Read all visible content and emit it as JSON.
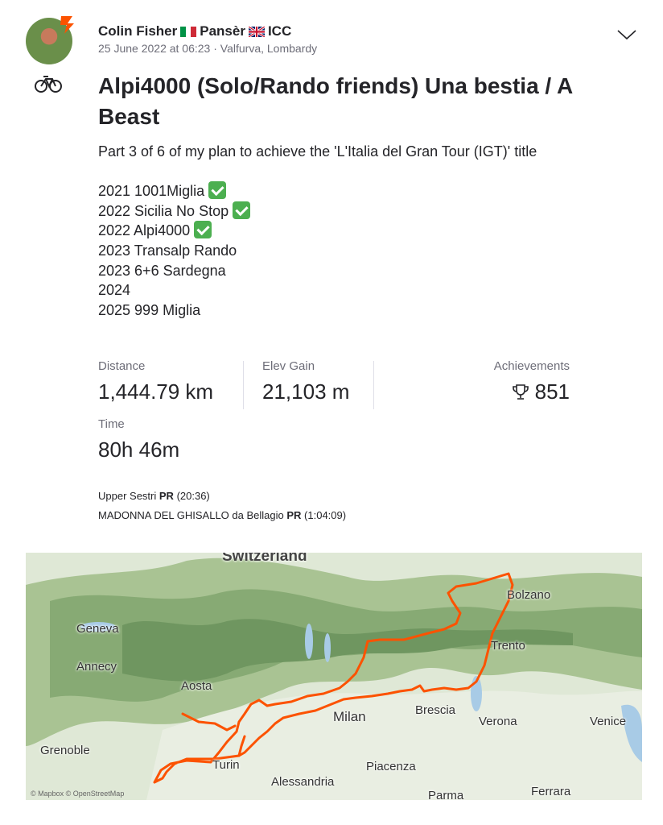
{
  "athlete": {
    "name": "Colin Fisher",
    "club1": "Pansèr",
    "club2": "ICC",
    "meta": "25 June 2022 at 06:23 · Valfurva, Lombardy"
  },
  "activity": {
    "title": "Alpi4000 (Solo/Rando friends) Una bestia / A Beast",
    "description_intro": "Part 3 of 6 of my plan to achieve the 'L'Italia del Gran Tour (IGT)' title",
    "plan": [
      {
        "text": "2021 1001Miglia",
        "done": true
      },
      {
        "text": "2022 Sicilia No Stop",
        "done": true
      },
      {
        "text": "2022 Alpi4000",
        "done": true
      },
      {
        "text": "2023 Transalp Rando",
        "done": false
      },
      {
        "text": "2023 6+6 Sardegna",
        "done": false
      },
      {
        "text": "2024",
        "done": false
      },
      {
        "text": "2025 999 Miglia",
        "done": false
      }
    ]
  },
  "stats": {
    "distance_label": "Distance",
    "distance_value": "1,444.79 km",
    "elev_label": "Elev Gain",
    "elev_value": "21,103 m",
    "achievements_label": "Achievements",
    "achievements_value": "851",
    "time_label": "Time",
    "time_value": "80h 46m"
  },
  "segments": [
    {
      "name": "Upper Sestri",
      "badge": "PR",
      "time": "(20:36)"
    },
    {
      "name": "MADONNA DEL GHISALLO da Bellagio",
      "badge": "PR",
      "time": "(1:04:09)"
    }
  ],
  "map": {
    "labels": {
      "switzerland": "Switzerland",
      "geneva": "Geneva",
      "annecy": "Annecy",
      "aosta": "Aosta",
      "grenoble": "Grenoble",
      "turin": "Turin",
      "alessandria": "Alessandria",
      "milan": "Milan",
      "piacenza": "Piacenza",
      "brescia": "Brescia",
      "verona": "Verona",
      "venice": "Venice",
      "parma": "Parma",
      "ferrara": "Ferrara",
      "bolzano": "Bolzano",
      "trento": "Trento"
    },
    "attribution": "© Mapbox © OpenStreetMap",
    "route_color": "#fc5200"
  }
}
